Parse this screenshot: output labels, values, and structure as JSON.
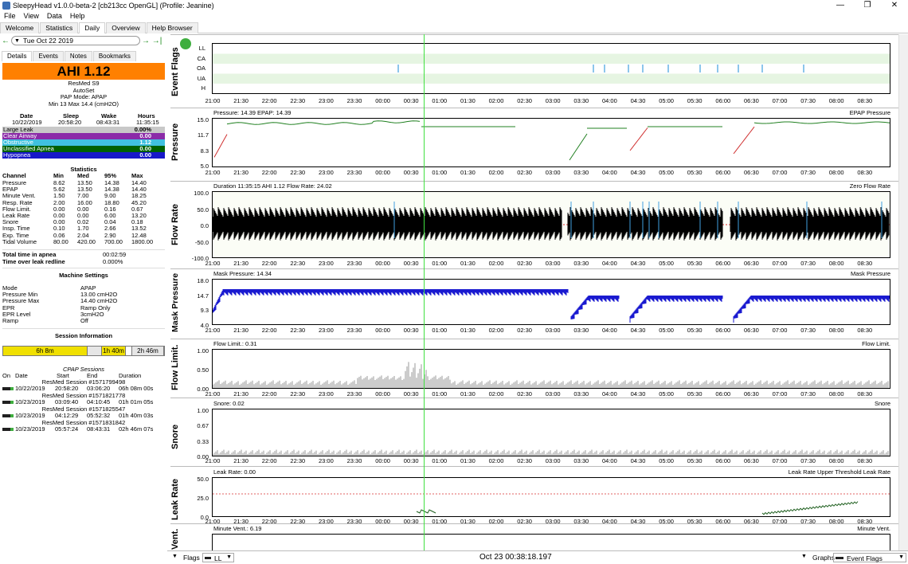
{
  "window": {
    "title": "SleepyHead v1.0.0-beta-2 [cb213cc OpenGL] (Profile: Jeanine)",
    "minimize": "—",
    "maximize": "❐",
    "close": "✕"
  },
  "menu": [
    "File",
    "View",
    "Data",
    "Help"
  ],
  "tabs": [
    "Welcome",
    "Statistics",
    "Daily",
    "Overview",
    "Help Browser"
  ],
  "date_nav": {
    "prev": "←",
    "date": "Tue Oct 22 2019",
    "next": "→",
    "last": "→|"
  },
  "subtabs": [
    "Details",
    "Events",
    "Notes",
    "Bookmarks"
  ],
  "ahi_label": "AHI 1.12",
  "device": {
    "model": "ResMed S9",
    "mode_name": "AutoSet",
    "pap_mode": "PAP Mode: APAP",
    "pressure_range": "Min 13 Max 14.4 (cmH2O)"
  },
  "summary": {
    "headers": [
      "Date",
      "Sleep",
      "Wake",
      "Hours"
    ],
    "values": [
      "10/22/2019",
      "20:58:20",
      "08:43:31",
      "11:35:15"
    ]
  },
  "indices": [
    {
      "label": "Large Leak",
      "value": "0.00%",
      "color": "#c8c8c8",
      "text": "#000"
    },
    {
      "label": "Clear Airway",
      "value": "0.00",
      "color": "#8b2ba8",
      "text": "#fff"
    },
    {
      "label": "Obstructive",
      "value": "1.12",
      "color": "#40c0e0",
      "text": "#fff"
    },
    {
      "label": "Unclassified Apnea",
      "value": "0.00",
      "color": "#006000",
      "text": "#fff"
    },
    {
      "label": "Hypopnea",
      "value": "0.00",
      "color": "#1818c8",
      "text": "#fff"
    }
  ],
  "statistics": {
    "title": "Statistics",
    "headers": [
      "Channel",
      "Min",
      "Med",
      "95%",
      "Max"
    ],
    "rows": [
      [
        "Pressure",
        "8.62",
        "13.50",
        "14.38",
        "14.40"
      ],
      [
        "EPAP",
        "5.62",
        "13.50",
        "14.38",
        "14.40"
      ],
      [
        "Minute Vent.",
        "1.50",
        "7.00",
        "9.00",
        "18.25"
      ],
      [
        "Resp. Rate",
        "2.00",
        "16.00",
        "18.80",
        "45.20"
      ],
      [
        "Flow Limit.",
        "0.00",
        "0.00",
        "0.16",
        "0.67"
      ],
      [
        "Leak Rate",
        "0.00",
        "0.00",
        "6.00",
        "13.20"
      ],
      [
        "Snore",
        "0.00",
        "0.02",
        "0.04",
        "0.18"
      ],
      [
        "Insp. Time",
        "0.10",
        "1.70",
        "2.66",
        "13.52"
      ],
      [
        "Exp. Time",
        "0.06",
        "2.04",
        "2.90",
        "12.48"
      ],
      [
        "Tidal Volume",
        "80.00",
        "420.00",
        "700.00",
        "1800.00"
      ]
    ]
  },
  "apnea_time": {
    "label": "Total time in apnea",
    "value": "00:02:59"
  },
  "leak_time": {
    "label": "Time over leak redline",
    "value": "0.000%"
  },
  "machine": {
    "title": "Machine Settings",
    "rows": [
      [
        "Mode",
        "APAP"
      ],
      [
        "Pressure Min",
        "13.00 cmH2O"
      ],
      [
        "Pressure Max",
        "14.40 cmH2O"
      ],
      [
        "EPR",
        "Ramp Only"
      ],
      [
        "EPR Level",
        "3cmH2O"
      ],
      [
        "Ramp",
        "Off"
      ]
    ]
  },
  "session_info": {
    "title": "Session Information",
    "segments": [
      "6h 8m",
      "1h 40m",
      "2h 46m"
    ]
  },
  "cpap_sessions": {
    "title": "CPAP Sessions",
    "headers": [
      "On",
      "Date",
      "Start",
      "End",
      "Duration"
    ],
    "rows": [
      {
        "name": "ResMed Session #1571799498",
        "date": "10/22/2019",
        "start": "20:58:20",
        "end": "03:06:20",
        "duration": "06h 08m 00s"
      },
      {
        "name": "ResMed Session #1571821778",
        "date": "10/23/2019",
        "start": "03:09:40",
        "end": "04:10:45",
        "duration": "01h 01m 05s"
      },
      {
        "name": "ResMed Session #1571825547",
        "date": "10/23/2019",
        "start": "04:12:29",
        "end": "05:52:32",
        "duration": "01h 40m 03s"
      },
      {
        "name": "ResMed Session #1571831842",
        "date": "10/23/2019",
        "start": "05:57:24",
        "end": "08:43:31",
        "duration": "02h 46m 07s"
      }
    ]
  },
  "graphs": {
    "xticks": [
      "21:00",
      "21:30",
      "22:00",
      "22:30",
      "23:00",
      "23:30",
      "00:00",
      "00:30",
      "01:00",
      "01:30",
      "02:00",
      "02:30",
      "03:00",
      "03:30",
      "04:00",
      "04:30",
      "05:00",
      "05:30",
      "06:00",
      "06:30",
      "07:00",
      "07:30",
      "08:00",
      "08:30"
    ],
    "event_flags": {
      "label": "Event Flags",
      "rows": [
        "LL",
        "CA",
        "OA",
        "UA",
        "H"
      ]
    },
    "pressure": {
      "label": "Pressure",
      "title": "Pressure: 14.39 EPAP: 14.39",
      "legend": "EPAP Pressure",
      "yticks": [
        "15.0",
        "11.7",
        "8.3",
        "5.0"
      ]
    },
    "flow": {
      "label": "Flow Rate",
      "title": "Duration 11:35:15 AHI 1.12 Flow Rate: 24.02",
      "legend": "Zero Flow Rate",
      "yticks": [
        "100.0",
        "50.0",
        "0.0",
        "-50.0",
        "-100.0"
      ]
    },
    "mask": {
      "label": "Mask Pressure",
      "title": "Mask Pressure: 14.34",
      "legend": "Mask Pressure",
      "yticks": [
        "18.0",
        "14.7",
        "9.3",
        "4.0"
      ]
    },
    "flowlim": {
      "label": "Flow Limit.",
      "title": "Flow Limit.: 0.31",
      "legend": "Flow Limit.",
      "yticks": [
        "1.00",
        "0.50",
        "0.00"
      ]
    },
    "snore": {
      "label": "Snore",
      "title": "Snore: 0.02",
      "legend": "Snore",
      "yticks": [
        "1.00",
        "0.67",
        "0.33",
        "0.00"
      ]
    },
    "leak": {
      "label": "Leak Rate",
      "title": "Leak Rate: 0.00",
      "legend": "Leak Rate Upper Threshold Leak Rate",
      "yticks": [
        "50.0",
        "25.0",
        "0.0"
      ]
    },
    "minvent": {
      "label": "Vent.",
      "title": "Minute Vent.: 6.19",
      "legend": "Minute Vent."
    }
  },
  "bottom": {
    "flags": "Flags",
    "flag_value": "LL",
    "time": "Oct 23 00:38:18.197",
    "graphs": "Graphs",
    "graph_value": "Event Flags"
  }
}
